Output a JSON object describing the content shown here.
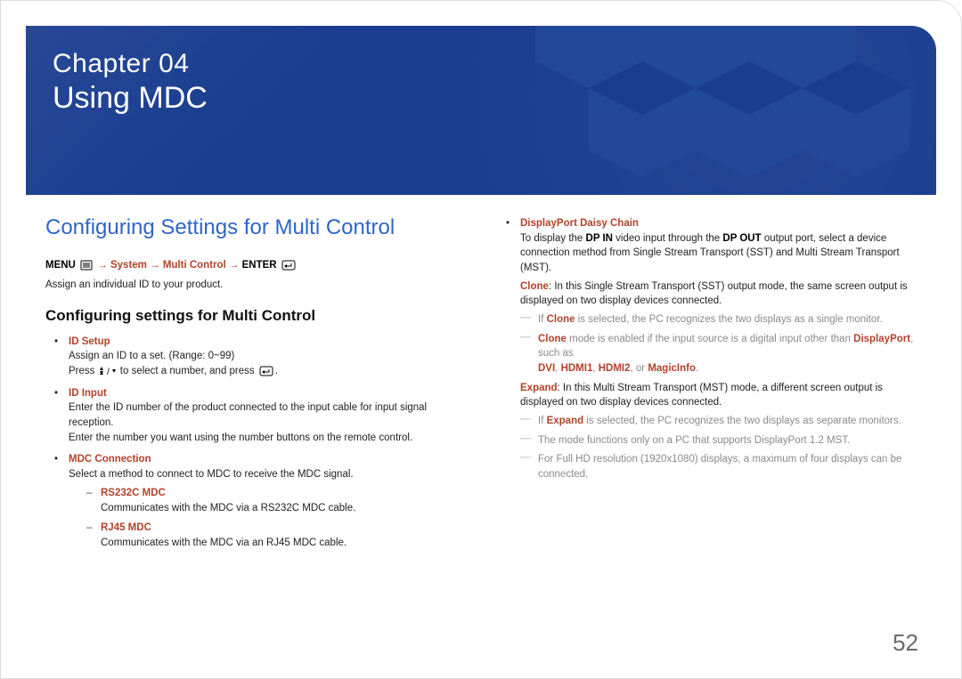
{
  "chapter_label": "Chapter  04",
  "chapter_title": "Using MDC",
  "section_title": "Configuring Settings for Multi Control",
  "nav": {
    "menu": "MENU",
    "system": "System",
    "multi_control": "Multi Control",
    "enter": "ENTER",
    "arrow": "→"
  },
  "intro": "Assign an individual ID to your product.",
  "subheading": "Configuring settings for Multi Control",
  "left": {
    "id_setup": {
      "label": "ID Setup",
      "line1": "Assign an ID to a set. (Range: 0~99)",
      "line2a": "Press ",
      "line2b": " to select a number, and press "
    },
    "id_input": {
      "label": "ID Input",
      "line1": "Enter the ID number of the product connected to the input cable for input signal reception.",
      "line2": "Enter the number you want using the number buttons on the remote control."
    },
    "mdc_conn": {
      "label": "MDC Connection",
      "line1": "Select a method to connect to MDC to receive the MDC signal.",
      "rs232c": {
        "label": "RS232C MDC",
        "desc": "Communicates with the MDC via a RS232C MDC cable."
      },
      "rj45": {
        "label": "RJ45 MDC",
        "desc": "Communicates with the MDC via an RJ45 MDC cable."
      }
    }
  },
  "right": {
    "dp_chain_label": "DisplayPort Daisy Chain",
    "desc_pre": "To display the ",
    "dp_in": "DP IN",
    "desc_mid": " video input through the ",
    "dp_out": "DP OUT",
    "desc_post": " output port, select a device connection method from Single Stream Transport (SST) and Multi Stream Transport (MST).",
    "clone": {
      "label": "Clone",
      "desc": ": In this Single Stream Transport (SST) output mode, the same screen output is displayed on two display devices connected.",
      "note1_pre": "If ",
      "note1_post": " is selected, the PC recognizes the two displays as a single monitor.",
      "note2_pre": "",
      "note2_mid": " mode is enabled if the input source is a digital input other than ",
      "displayport": "DisplayPort",
      "note2_post": ", such as ",
      "dvi": "DVI",
      "hdmi1": "HDMI1",
      "hdmi2": "HDMI2",
      "or": ", or ",
      "magicinfo": "MagicInfo",
      "period": "."
    },
    "expand": {
      "label": "Expand",
      "desc": ": In this Multi Stream Transport (MST) mode, a different screen output is displayed on two display devices connected.",
      "note1_pre": "If ",
      "note1_post": " is selected, the PC recognizes the two displays as separate monitors.",
      "note2": "The mode functions only on a PC that supports DisplayPort 1.2 MST.",
      "note3": "For Full HD resolution (1920x1080) displays, a maximum of four displays can be connected."
    }
  },
  "page_number": "52"
}
